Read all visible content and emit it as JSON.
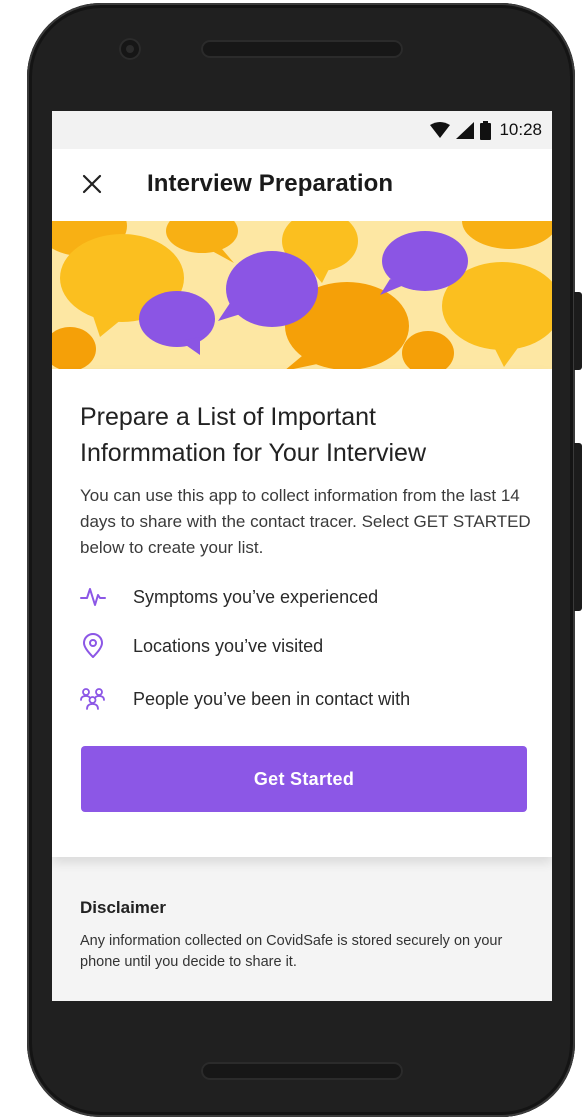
{
  "status_bar": {
    "time": "10:28",
    "icons": [
      "wifi-icon",
      "signal-icon",
      "battery-icon"
    ]
  },
  "app_bar": {
    "close_icon": "close-icon",
    "title": "Interview Preparation"
  },
  "hero": {
    "illustration": "speech-bubbles-illustration"
  },
  "card": {
    "title": "Prepare a List of Important Informmation for Your Interview",
    "body": "You can use this app to collect information from the last 14 days to share with the contact tracer. Select GET STARTED below to create your list.",
    "features": [
      {
        "icon": "pulse-icon",
        "label": "Symptoms you’ve experienced"
      },
      {
        "icon": "location-pin-icon",
        "label": "Locations you’ve visited"
      },
      {
        "icon": "people-icon",
        "label": "People you’ve been in contact with"
      }
    ],
    "cta_label": "Get Started"
  },
  "disclaimer": {
    "title": "Disclaimer",
    "text": "Any information collected on CovidSafe is stored securely on your phone until you decide to share it."
  },
  "colors": {
    "accent": "#8c57e6",
    "hero_background": "#fde7a3",
    "bubble_yellow": "#fbbf1f",
    "bubble_orange": "#f5a008",
    "bubble_purple": "#8b55e4"
  }
}
